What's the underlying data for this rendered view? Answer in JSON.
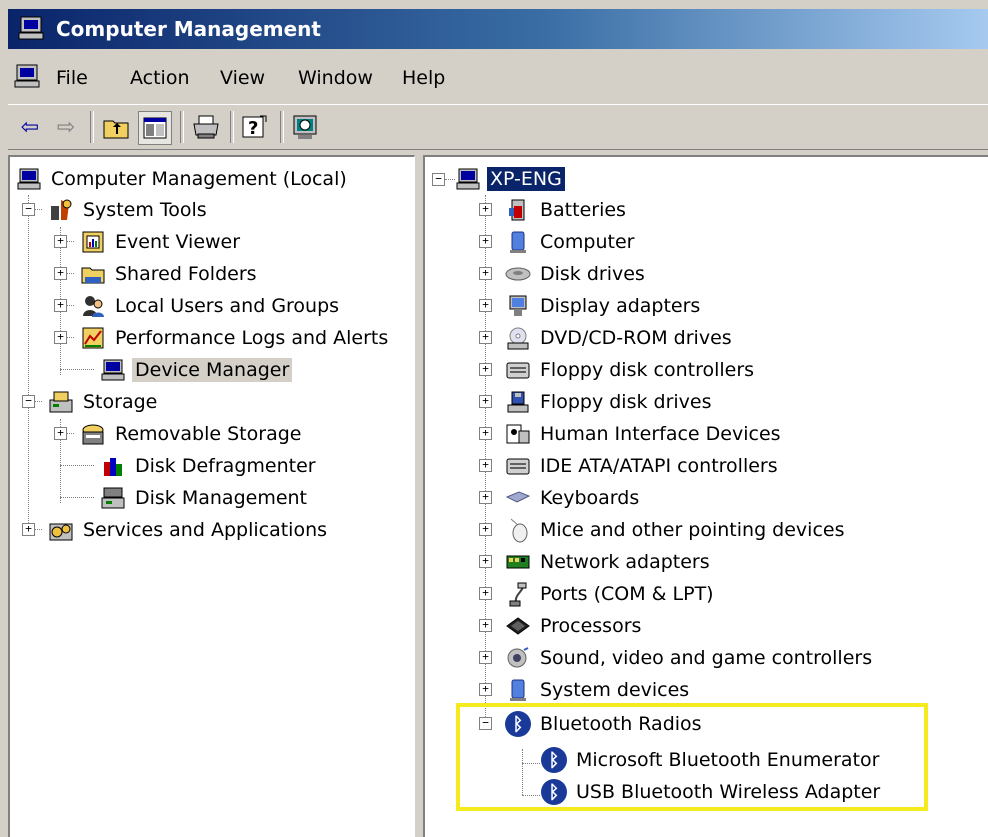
{
  "window": {
    "title": "Computer Management"
  },
  "menu": [
    "File",
    "Action",
    "View",
    "Window",
    "Help"
  ],
  "tree_left": [
    {
      "label": "Computer Management (Local)"
    },
    {
      "label": "System Tools"
    },
    {
      "label": "Event Viewer"
    },
    {
      "label": "Shared Folders"
    },
    {
      "label": "Local Users and Groups"
    },
    {
      "label": "Performance Logs and Alerts"
    },
    {
      "label": "Device Manager"
    },
    {
      "label": "Storage"
    },
    {
      "label": "Removable Storage"
    },
    {
      "label": "Disk Defragmenter"
    },
    {
      "label": "Disk Management"
    },
    {
      "label": "Services and Applications"
    }
  ],
  "tree_right": {
    "root": "XP-ENG",
    "categories": [
      "Batteries",
      "Computer",
      "Disk drives",
      "Display adapters",
      "DVD/CD-ROM drives",
      "Floppy disk controllers",
      "Floppy disk drives",
      "Human Interface Devices",
      "IDE ATA/ATAPI controllers",
      "Keyboards",
      "Mice and other pointing devices",
      "Network adapters",
      "Ports (COM & LPT)",
      "Processors",
      "Sound, video and game controllers",
      "System devices",
      "Bluetooth Radios"
    ],
    "bluetooth_children": [
      "Microsoft Bluetooth Enumerator",
      "USB Bluetooth Wireless Adapter"
    ]
  },
  "colors": {
    "highlight_box": "#f4ea1e",
    "selection": "#0a246a",
    "title_bar": "#0a246a"
  }
}
